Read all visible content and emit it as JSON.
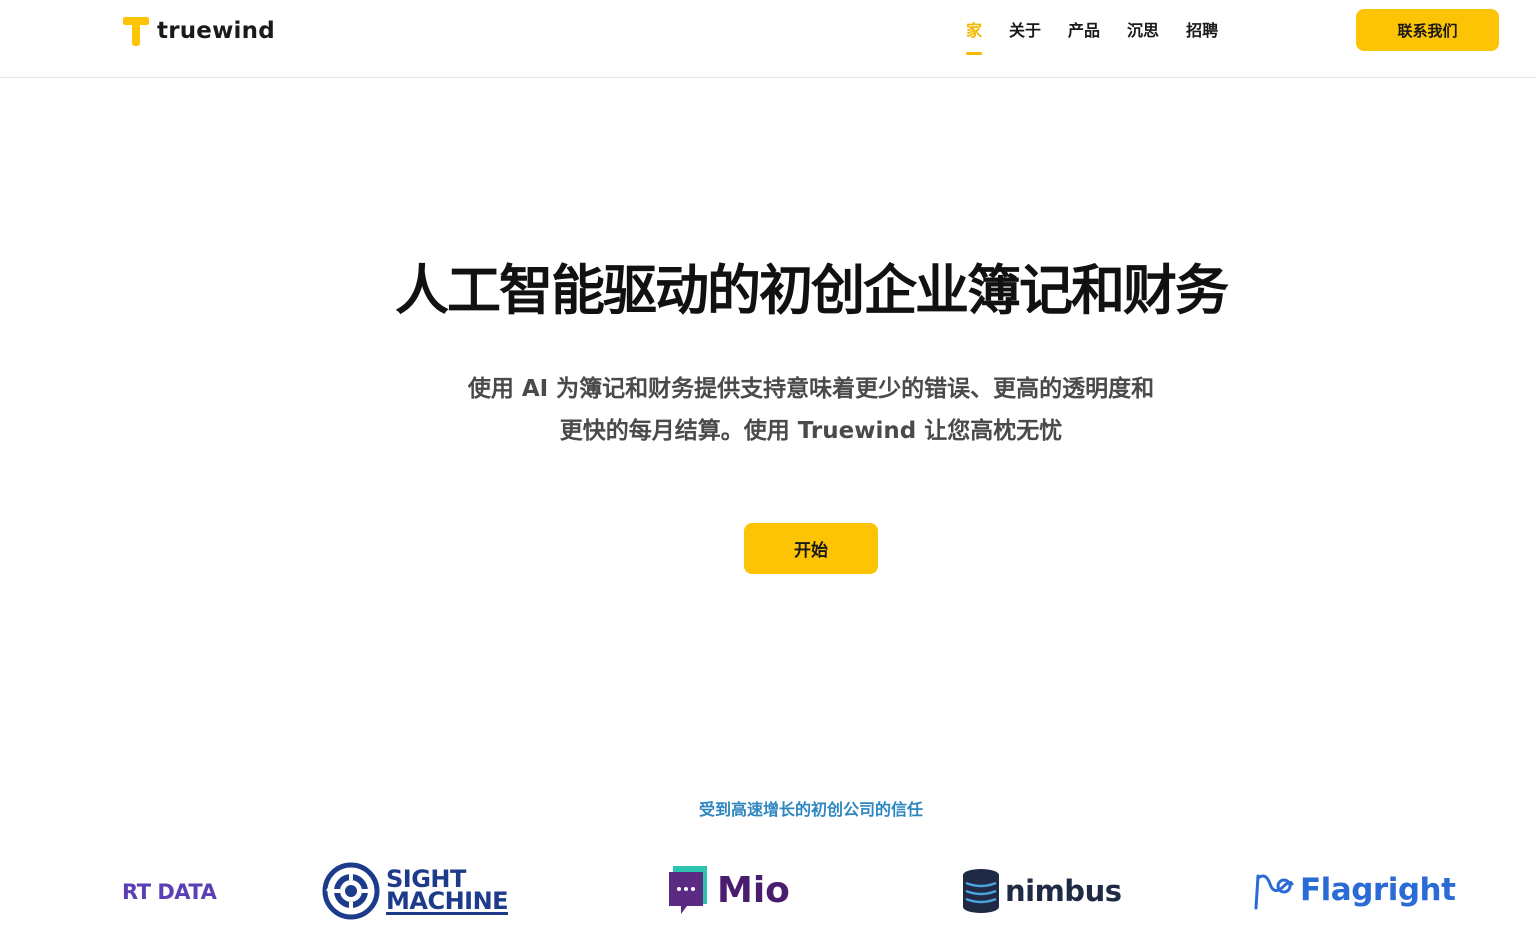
{
  "header": {
    "brand": "truewind",
    "nav": [
      {
        "label": "家",
        "active": true
      },
      {
        "label": "关于",
        "active": false
      },
      {
        "label": "产品",
        "active": false
      },
      {
        "label": "沉思",
        "active": false
      },
      {
        "label": "招聘",
        "active": false
      }
    ],
    "contact_label": "联系我们"
  },
  "hero": {
    "title": "人工智能驱动的初创企业簿记和财务",
    "subtitle_line1": "使用 AI 为簿记和财务提供支持意味着更少的错误、更高的透明度和",
    "subtitle_line2": "更快的每月结算。使用 Truewind 让您高枕无忧",
    "cta_label": "开始"
  },
  "trusted": {
    "heading": "受到高速增长的初创公司的信任",
    "logos": [
      {
        "text": "RT DATA",
        "icon": "smartdata-logo"
      },
      {
        "text_line1": "SIGHT",
        "text_line2": "MACHINE",
        "icon": "gear-eye-icon"
      },
      {
        "text": "Mio",
        "icon": "chat-bubble-icon"
      },
      {
        "text": "nimbus",
        "icon": "stacked-layers-icon"
      },
      {
        "text": "Flagright",
        "icon": "flag-swirl-icon"
      }
    ]
  },
  "colors": {
    "accent": "#fdc305",
    "active_nav": "#f5b800",
    "trusted_heading": "#2e86c1"
  }
}
